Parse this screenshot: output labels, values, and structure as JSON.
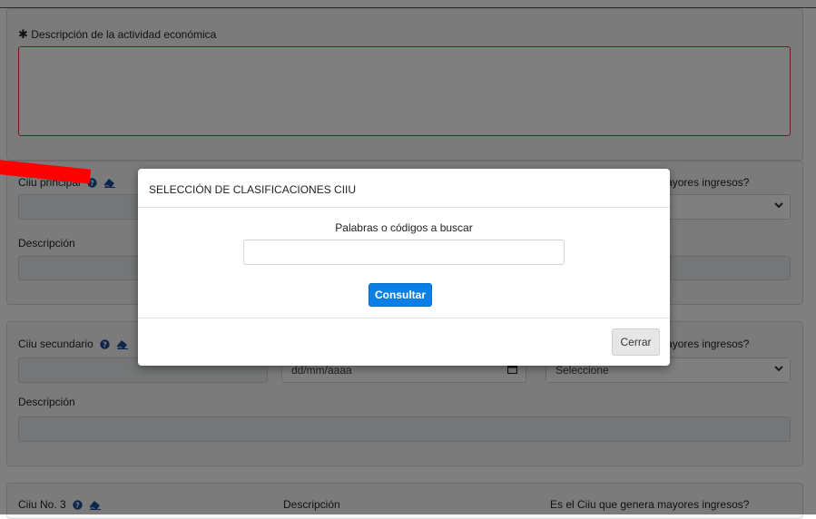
{
  "form": {
    "required_marker": "✱",
    "description_label": "Descripción de la actividad económica",
    "ciiu_principal_label": "Ciiu principal",
    "ciiu_principal_income_label": "Es el Ciiu que genera mayores ingresos?",
    "principal_desc_label": "Descripción",
    "ciiu_secundario_label": "Ciiu secundario",
    "secundario_income_label": "Es el Ciiu que genera mayores ingresos?",
    "secundario_date_placeholder": "dd/mm/aaaa",
    "secundario_select_value": "Seleccione",
    "secundario_desc_label": "Descripción",
    "ciiu3_label": "Ciiu No. 3",
    "ciiu3_desc_label": "Descripción",
    "ciiu3_income_label": "Es el Ciiu que genera mayores ingresos?"
  },
  "modal": {
    "title": "SELECCIÓN DE CLASIFICACIONES CIIU",
    "search_label": "Palabras o códigos a buscar",
    "search_value": "",
    "consult_button": "Consultar",
    "close_button": "Cerrar"
  },
  "icons": {
    "help": "question-circle-icon",
    "eraser": "eraser-icon",
    "calendar": "calendar-icon",
    "chevron": "chevron-down-icon"
  },
  "colors": {
    "primary": "#0b7fe4",
    "error_border": "#e3353d",
    "annotation": "#ff0000"
  }
}
